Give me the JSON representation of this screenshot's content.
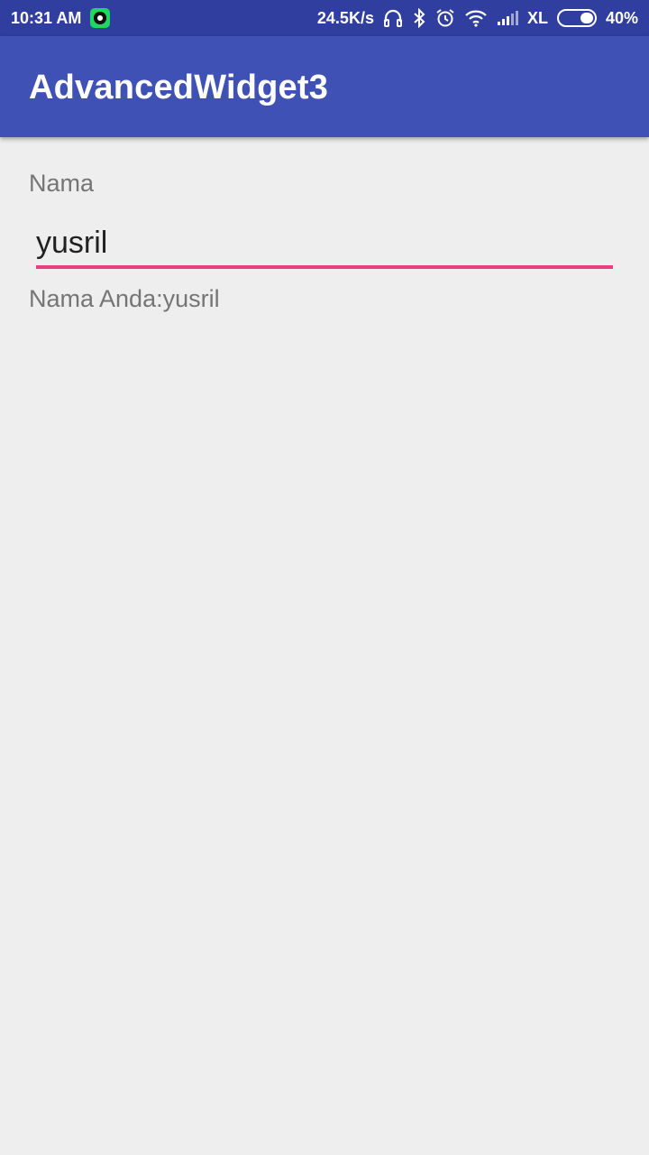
{
  "status_bar": {
    "time": "10:31 AM",
    "net_speed": "24.5K/s",
    "carrier": "XL",
    "battery_percent": "40%",
    "battery_level": 0.4,
    "icons": [
      "app-notification-icon",
      "headset-icon",
      "bluetooth-icon",
      "alarm-icon",
      "wifi-icon",
      "signal-icon",
      "battery-icon"
    ]
  },
  "app_bar": {
    "title": "AdvancedWidget3",
    "color": "#3f51b5"
  },
  "form": {
    "label": "Nama",
    "input_value": "yusril",
    "accent_color": "#e83e7c",
    "result_text": "Nama Anda:yusril"
  }
}
